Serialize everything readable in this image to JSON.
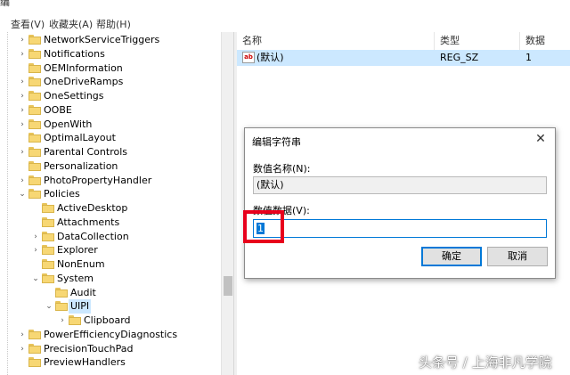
{
  "menubar": {
    "partial_char": "编",
    "items": [
      "查看(V)",
      "收藏夹(A)",
      "帮助(H)"
    ]
  },
  "tree": {
    "items": [
      {
        "label": "NetworkServiceTriggers",
        "expander": "›"
      },
      {
        "label": "Notifications",
        "expander": "›"
      },
      {
        "label": "OEMInformation",
        "expander": ""
      },
      {
        "label": "OneDriveRamps",
        "expander": "›"
      },
      {
        "label": "OneSettings",
        "expander": "›"
      },
      {
        "label": "OOBE",
        "expander": "›"
      },
      {
        "label": "OpenWith",
        "expander": "›"
      },
      {
        "label": "OptimalLayout",
        "expander": ""
      },
      {
        "label": "Parental Controls",
        "expander": "›"
      },
      {
        "label": "Personalization",
        "expander": ""
      },
      {
        "label": "PhotoPropertyHandler",
        "expander": "›"
      },
      {
        "label": "Policies",
        "expander": "⌄"
      },
      {
        "label": "ActiveDesktop",
        "expander": ""
      },
      {
        "label": "Attachments",
        "expander": ""
      },
      {
        "label": "DataCollection",
        "expander": "›"
      },
      {
        "label": "Explorer",
        "expander": "›"
      },
      {
        "label": "NonEnum",
        "expander": ""
      },
      {
        "label": "System",
        "expander": "⌄"
      },
      {
        "label": "Audit",
        "expander": ""
      },
      {
        "label": "UIPI",
        "expander": "⌄"
      },
      {
        "label": "Clipboard",
        "expander": "›"
      },
      {
        "label": "PowerEfficiencyDiagnostics",
        "expander": "›"
      },
      {
        "label": "PrecisionTouchPad",
        "expander": "›"
      },
      {
        "label": "PreviewHandlers",
        "expander": ""
      }
    ]
  },
  "list": {
    "headers": [
      "名称",
      "类型",
      "数据"
    ],
    "row": {
      "icon": "ab",
      "name": "(默认)",
      "type": "REG_SZ",
      "data": "1"
    }
  },
  "dialog": {
    "title": "编辑字符串",
    "name_label": "数值名称(N):",
    "name_value": "(默认)",
    "data_label": "数值数据(V):",
    "data_value": "1",
    "ok": "确定",
    "cancel": "取消"
  },
  "watermark": "头条号 / 上海非凡学院",
  "colors": {
    "accent": "#0078d7",
    "highlight_box": "#e8001c",
    "selection": "#cce8ff"
  }
}
